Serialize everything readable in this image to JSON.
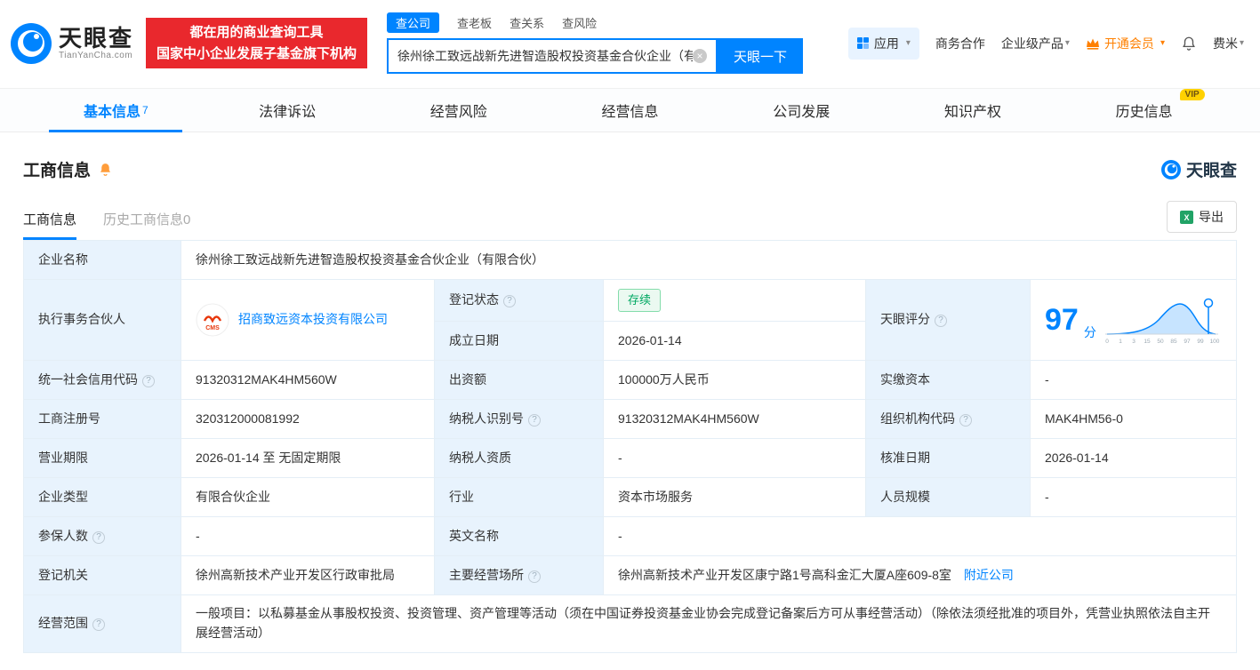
{
  "brand": {
    "logo_text": "天眼查",
    "logo_sub": "TianYanCha.com",
    "banner_line1": "都在用的商业查询工具",
    "banner_line2": "国家中小企业发展子基金旗下机构"
  },
  "search": {
    "tabs": [
      {
        "label": "查公司",
        "active": true
      },
      {
        "label": "查老板",
        "active": false
      },
      {
        "label": "查关系",
        "active": false
      },
      {
        "label": "查风险",
        "active": false
      }
    ],
    "query": "徐州徐工致远战新先进智造股权投资基金合伙企业（有",
    "button": "天眼一下"
  },
  "header_right": {
    "apps": "应用",
    "biz": "商务合作",
    "enterprise": "企业级产品",
    "vip": "开通会员",
    "user": "费米"
  },
  "nav_tabs": [
    {
      "label": "基本信息",
      "count": "7",
      "active": true
    },
    {
      "label": "法律诉讼"
    },
    {
      "label": "经营风险"
    },
    {
      "label": "经营信息"
    },
    {
      "label": "公司发展"
    },
    {
      "label": "知识产权"
    },
    {
      "label": "历史信息",
      "vip": "VIP"
    }
  ],
  "section": {
    "title": "工商信息",
    "brand_logo": "天眼查",
    "subtabs": [
      {
        "label": "工商信息",
        "active": true
      },
      {
        "label": "历史工商信息0",
        "active": false
      }
    ],
    "export_label": "导出"
  },
  "table": {
    "name": {
      "label": "企业名称",
      "value": "徐州徐工致远战新先进智造股权投资基金合伙企业（有限合伙）"
    },
    "partner": {
      "label": "执行事务合伙人",
      "value": "招商致远资本投资有限公司",
      "logo_text": "CMS"
    },
    "reg_status": {
      "label": "登记状态",
      "value": "存续"
    },
    "establish_date": {
      "label": "成立日期",
      "value": "2026-01-14"
    },
    "score": {
      "label": "天眼评分",
      "value": "97",
      "unit": "分",
      "axis": [
        "0",
        "1",
        "3",
        "15",
        "50",
        "85",
        "97",
        "99",
        "100"
      ]
    },
    "credit_code": {
      "label": "统一社会信用代码",
      "value": "91320312MAK4HM560W"
    },
    "capital": {
      "label": "出资额",
      "value": "100000万人民币"
    },
    "paid_capital": {
      "label": "实缴资本",
      "value": "-"
    },
    "reg_no": {
      "label": "工商注册号",
      "value": "320312000081992"
    },
    "taxpayer_id": {
      "label": "纳税人识别号",
      "value": "91320312MAK4HM560W"
    },
    "org_code": {
      "label": "组织机构代码",
      "value": "MAK4HM56-0"
    },
    "term": {
      "label": "营业期限",
      "value": "2026-01-14 至 无固定期限"
    },
    "taxpayer_quality": {
      "label": "纳税人资质",
      "value": "-"
    },
    "approval_date": {
      "label": "核准日期",
      "value": "2026-01-14"
    },
    "type": {
      "label": "企业类型",
      "value": "有限合伙企业"
    },
    "industry": {
      "label": "行业",
      "value": "资本市场服务"
    },
    "staff": {
      "label": "人员规模",
      "value": "-"
    },
    "insured": {
      "label": "参保人数",
      "value": "-"
    },
    "en_name": {
      "label": "英文名称",
      "value": "-"
    },
    "authority": {
      "label": "登记机关",
      "value": "徐州高新技术产业开发区行政审批局"
    },
    "address": {
      "label": "主要经营场所",
      "value": "徐州高新技术产业开发区康宁路1号高科金汇大厦A座609-8室",
      "link": "附近公司"
    },
    "scope": {
      "label": "经营范围",
      "value": "一般项目：以私募基金从事股权投资、投资管理、资产管理等活动（须在中国证券投资基金业协会完成登记备案后方可从事经营活动）（除依法须经批准的项目外，凭营业执照依法自主开展经营活动）"
    }
  },
  "icons": {
    "search_clear": "×",
    "caret_down": "▾",
    "help": "?",
    "export_excel": "X",
    "logo": "eye-swirl",
    "apps": "grid",
    "member": "crown",
    "notification": "bell",
    "announcement": "bell"
  },
  "colors": {
    "brand_blue": "#0084ff",
    "banner_red": "#e9282d",
    "status_green": "#00a862",
    "member_orange": "#ff8000",
    "vip_yellow": "#ffd100"
  }
}
